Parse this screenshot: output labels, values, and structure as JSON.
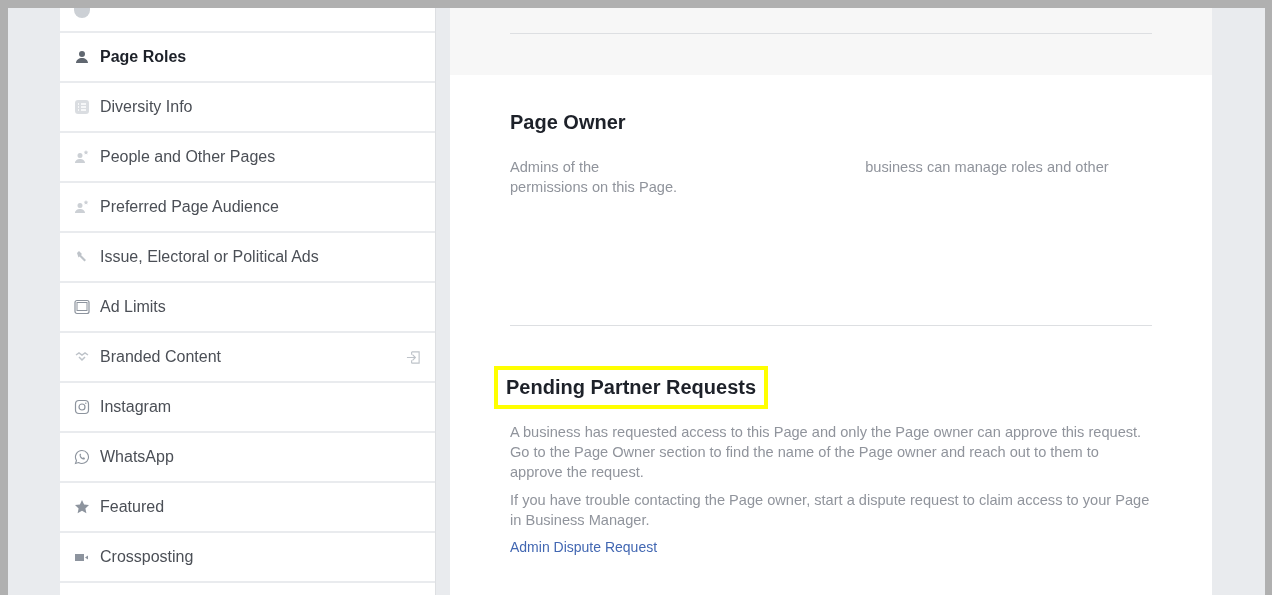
{
  "sidebar": {
    "items": [
      {
        "label": "Page Roles",
        "selected": true,
        "external": false
      },
      {
        "label": "Diversity Info",
        "selected": false,
        "external": false
      },
      {
        "label": "People and Other Pages",
        "selected": false,
        "external": false
      },
      {
        "label": "Preferred Page Audience",
        "selected": false,
        "external": false
      },
      {
        "label": "Issue, Electoral or Political Ads",
        "selected": false,
        "external": false
      },
      {
        "label": "Ad Limits",
        "selected": false,
        "external": false
      },
      {
        "label": "Branded Content",
        "selected": false,
        "external": true
      },
      {
        "label": "Instagram",
        "selected": false,
        "external": false
      },
      {
        "label": "WhatsApp",
        "selected": false,
        "external": false
      },
      {
        "label": "Featured",
        "selected": false,
        "external": false
      },
      {
        "label": "Crossposting",
        "selected": false,
        "external": false
      }
    ]
  },
  "sections": [
    {
      "title": "Page Owner",
      "highlighted": false,
      "paragraphs": [
        {
          "kind": "redacted",
          "parts": [
            "Admins of the",
            "business can manage roles and other",
            "permissions on this Page."
          ]
        }
      ]
    },
    {
      "title": "Pending Partner Requests",
      "highlighted": true,
      "paragraphs": [
        {
          "kind": "plain",
          "parts": [
            "A business has requested access to this Page and only the Page owner can approve this request. Go to the Page Owner section to find the name of the Page owner and reach out to them to approve the request."
          ]
        },
        {
          "kind": "plain",
          "parts": [
            "If you have trouble contacting the Page owner, start a dispute request to claim access to your Page in Business Manager."
          ]
        }
      ],
      "link": "Admin Dispute Request"
    }
  ]
}
